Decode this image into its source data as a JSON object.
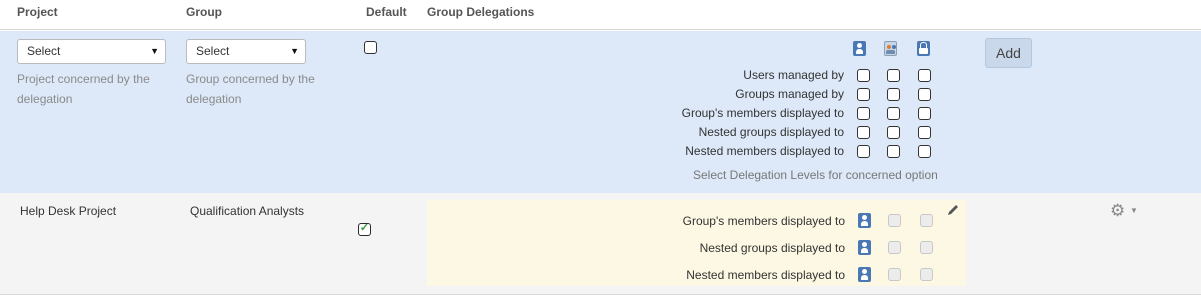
{
  "columns": {
    "project": "Project",
    "group": "Group",
    "default": "Default",
    "group_delegations": "Group Delegations"
  },
  "form": {
    "project_select": {
      "value": "Select",
      "help": "Project concerned by the delegation"
    },
    "group_select": {
      "value": "Select",
      "help": "Group concerned by the delegation"
    },
    "default_checked": false,
    "level_icons": [
      "user-level-icon",
      "group-level-icon",
      "lock-level-icon"
    ],
    "options": [
      {
        "label": "Users managed by"
      },
      {
        "label": "Groups managed by"
      },
      {
        "label": "Group's members displayed to"
      },
      {
        "label": "Nested groups displayed to"
      },
      {
        "label": "Nested members displayed to"
      }
    ],
    "hint": "Select Delegation Levels for concerned option",
    "add_label": "Add"
  },
  "rows": [
    {
      "project": "Help Desk Project",
      "group": "Qualification Analysts",
      "default_checked": true,
      "default_mark": "✓",
      "delegations": [
        {
          "label": "Group's members displayed to"
        },
        {
          "label": "Nested groups displayed to"
        },
        {
          "label": "Nested members displayed to"
        }
      ],
      "edit_icon": "pencil-icon",
      "actions_icon": "gear-icon"
    }
  ],
  "colors": {
    "form_bg": "#dde9f8",
    "row_bg": "#f4f4f4",
    "delegation_bg": "#fdf8e3",
    "icon_blue": "#4a78b5",
    "check_green": "#3a9b3a"
  }
}
